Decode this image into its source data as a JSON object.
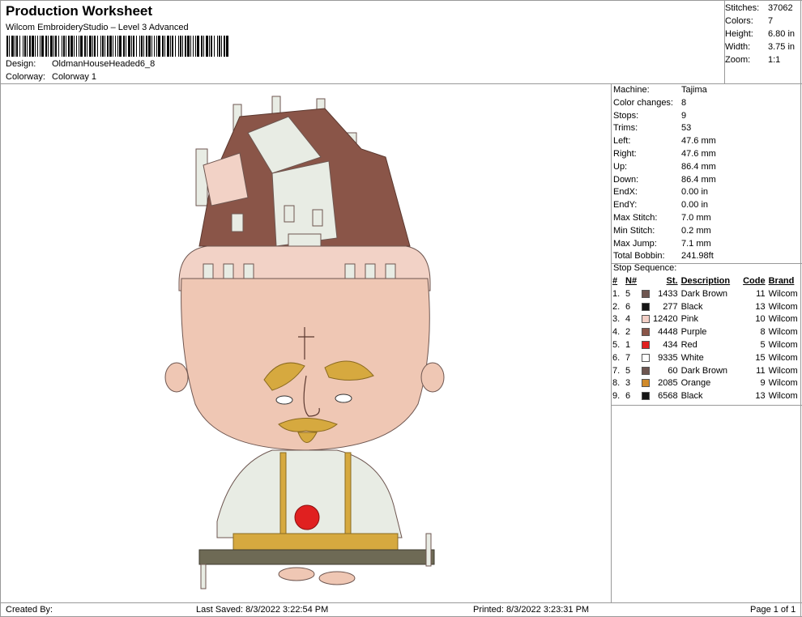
{
  "header": {
    "title": "Production Worksheet",
    "subtitle": "Wilcom EmbroideryStudio – Level 3 Advanced",
    "design_label": "Design:",
    "design_value": "OldmanHouseHeaded6_8",
    "colorway_label": "Colorway:",
    "colorway_value": "Colorway 1"
  },
  "stats": [
    {
      "label": "Stitches:",
      "value": "37062"
    },
    {
      "label": "Colors:",
      "value": "7"
    },
    {
      "label": "Height:",
      "value": "6.80 in"
    },
    {
      "label": "Width:",
      "value": "3.75 in"
    },
    {
      "label": "Zoom:",
      "value": "1:1"
    }
  ],
  "machine_info": [
    {
      "label": "Machine:",
      "value": "Tajima"
    },
    {
      "label": "Color changes:",
      "value": "8"
    },
    {
      "label": "Stops:",
      "value": "9"
    },
    {
      "label": "Trims:",
      "value": "53"
    },
    {
      "label": "Left:",
      "value": "47.6 mm"
    },
    {
      "label": "Right:",
      "value": "47.6 mm"
    },
    {
      "label": "Up:",
      "value": "86.4 mm"
    },
    {
      "label": "Down:",
      "value": "86.4 mm"
    },
    {
      "label": "EndX:",
      "value": "0.00 in"
    },
    {
      "label": "EndY:",
      "value": "0.00 in"
    },
    {
      "label": "Max Stitch:",
      "value": "7.0 mm"
    },
    {
      "label": "Min Stitch:",
      "value": "0.2 mm"
    },
    {
      "label": "Max Jump:",
      "value": "7.1 mm"
    },
    {
      "label": "Total Bobbin:",
      "value": "241.98ft"
    }
  ],
  "stop_sequence": {
    "title": "Stop Sequence:",
    "headers": {
      "idx": "#",
      "n": "N#",
      "st": "St.",
      "desc": "Description",
      "code": "Code",
      "brand": "Brand"
    },
    "rows": [
      {
        "idx": "1.",
        "n": "5",
        "color": "#6e5650",
        "st": "1433",
        "desc": "Dark Brown",
        "code": "11",
        "brand": "Wilcom"
      },
      {
        "idx": "2.",
        "n": "6",
        "color": "#151515",
        "st": "277",
        "desc": "Black",
        "code": "13",
        "brand": "Wilcom"
      },
      {
        "idx": "3.",
        "n": "4",
        "color": "#f3cfc6",
        "st": "12420",
        "desc": "Pink",
        "code": "10",
        "brand": "Wilcom"
      },
      {
        "idx": "4.",
        "n": "2",
        "color": "#8a5548",
        "st": "4448",
        "desc": "Purple",
        "code": "8",
        "brand": "Wilcom"
      },
      {
        "idx": "5.",
        "n": "1",
        "color": "#e02020",
        "st": "434",
        "desc": "Red",
        "code": "5",
        "brand": "Wilcom"
      },
      {
        "idx": "6.",
        "n": "7",
        "color": "#ffffff",
        "st": "9335",
        "desc": "White",
        "code": "15",
        "brand": "Wilcom"
      },
      {
        "idx": "7.",
        "n": "5",
        "color": "#6e5650",
        "st": "60",
        "desc": "Dark Brown",
        "code": "11",
        "brand": "Wilcom"
      },
      {
        "idx": "8.",
        "n": "3",
        "color": "#d08a2a",
        "st": "2085",
        "desc": "Orange",
        "code": "9",
        "brand": "Wilcom"
      },
      {
        "idx": "9.",
        "n": "6",
        "color": "#151515",
        "st": "6568",
        "desc": "Black",
        "code": "13",
        "brand": "Wilcom"
      }
    ]
  },
  "footer": {
    "created_by": "Created By:",
    "last_saved": "Last Saved: 8/3/2022 3:22:54 PM",
    "printed": "Printed: 8/3/2022 3:23:31 PM",
    "page": "Page 1 of 1"
  }
}
